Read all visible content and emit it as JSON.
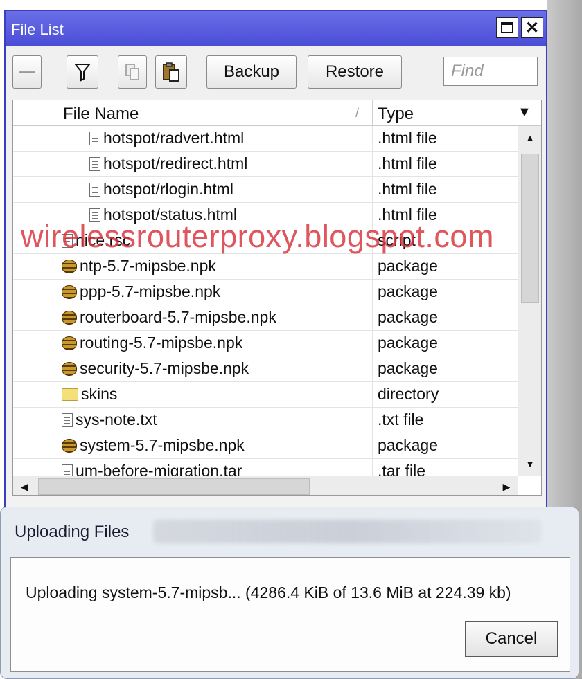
{
  "window": {
    "title": "File List",
    "maximize_icon": "maximize-icon",
    "close_icon": "close-icon",
    "close_glyph": "✕"
  },
  "toolbar": {
    "remove_glyph": "—",
    "filter_glyph": "Y",
    "backup_label": "Backup",
    "restore_label": "Restore",
    "find_placeholder": "Find"
  },
  "table": {
    "columns": [
      "File Name",
      "Type"
    ],
    "sort_indicator": "/",
    "rows": [
      {
        "name": "hotspot/radvert.html",
        "type": ".html file",
        "icon": "file-icon",
        "indent": 1
      },
      {
        "name": "hotspot/redirect.html",
        "type": ".html file",
        "icon": "file-icon",
        "indent": 1
      },
      {
        "name": "hotspot/rlogin.html",
        "type": ".html file",
        "icon": "file-icon",
        "indent": 1
      },
      {
        "name": "hotspot/status.html",
        "type": ".html file",
        "icon": "file-icon",
        "indent": 1
      },
      {
        "name": "nice.rsc",
        "type": "script",
        "icon": "file-icon",
        "indent": 0
      },
      {
        "name": "ntp-5.7-mipsbe.npk",
        "type": "package",
        "icon": "package-icon",
        "indent": 0
      },
      {
        "name": "ppp-5.7-mipsbe.npk",
        "type": "package",
        "icon": "package-icon",
        "indent": 0
      },
      {
        "name": "routerboard-5.7-mipsbe.npk",
        "type": "package",
        "icon": "package-icon",
        "indent": 0
      },
      {
        "name": "routing-5.7-mipsbe.npk",
        "type": "package",
        "icon": "package-icon",
        "indent": 0
      },
      {
        "name": "security-5.7-mipsbe.npk",
        "type": "package",
        "icon": "package-icon",
        "indent": 0
      },
      {
        "name": "skins",
        "type": "directory",
        "icon": "folder-icon",
        "indent": 0
      },
      {
        "name": "sys-note.txt",
        "type": ".txt file",
        "icon": "file-icon",
        "indent": 0
      },
      {
        "name": "system-5.7-mipsbe.npk",
        "type": "package",
        "icon": "package-icon",
        "indent": 0
      },
      {
        "name": "um-before-migration.tar",
        "type": ".tar file",
        "icon": "file-icon",
        "indent": 0
      }
    ]
  },
  "watermark": "wirelessrouterproxy.blogspot.com",
  "dialog": {
    "title": "Uploading Files",
    "message": "Uploading system-5.7-mipsb... (4286.4 KiB of 13.6 MiB at 224.39 kb)",
    "cancel_label": "Cancel"
  },
  "colors": {
    "title_bar": "#4a4ed6",
    "watermark": "#d8323c"
  }
}
